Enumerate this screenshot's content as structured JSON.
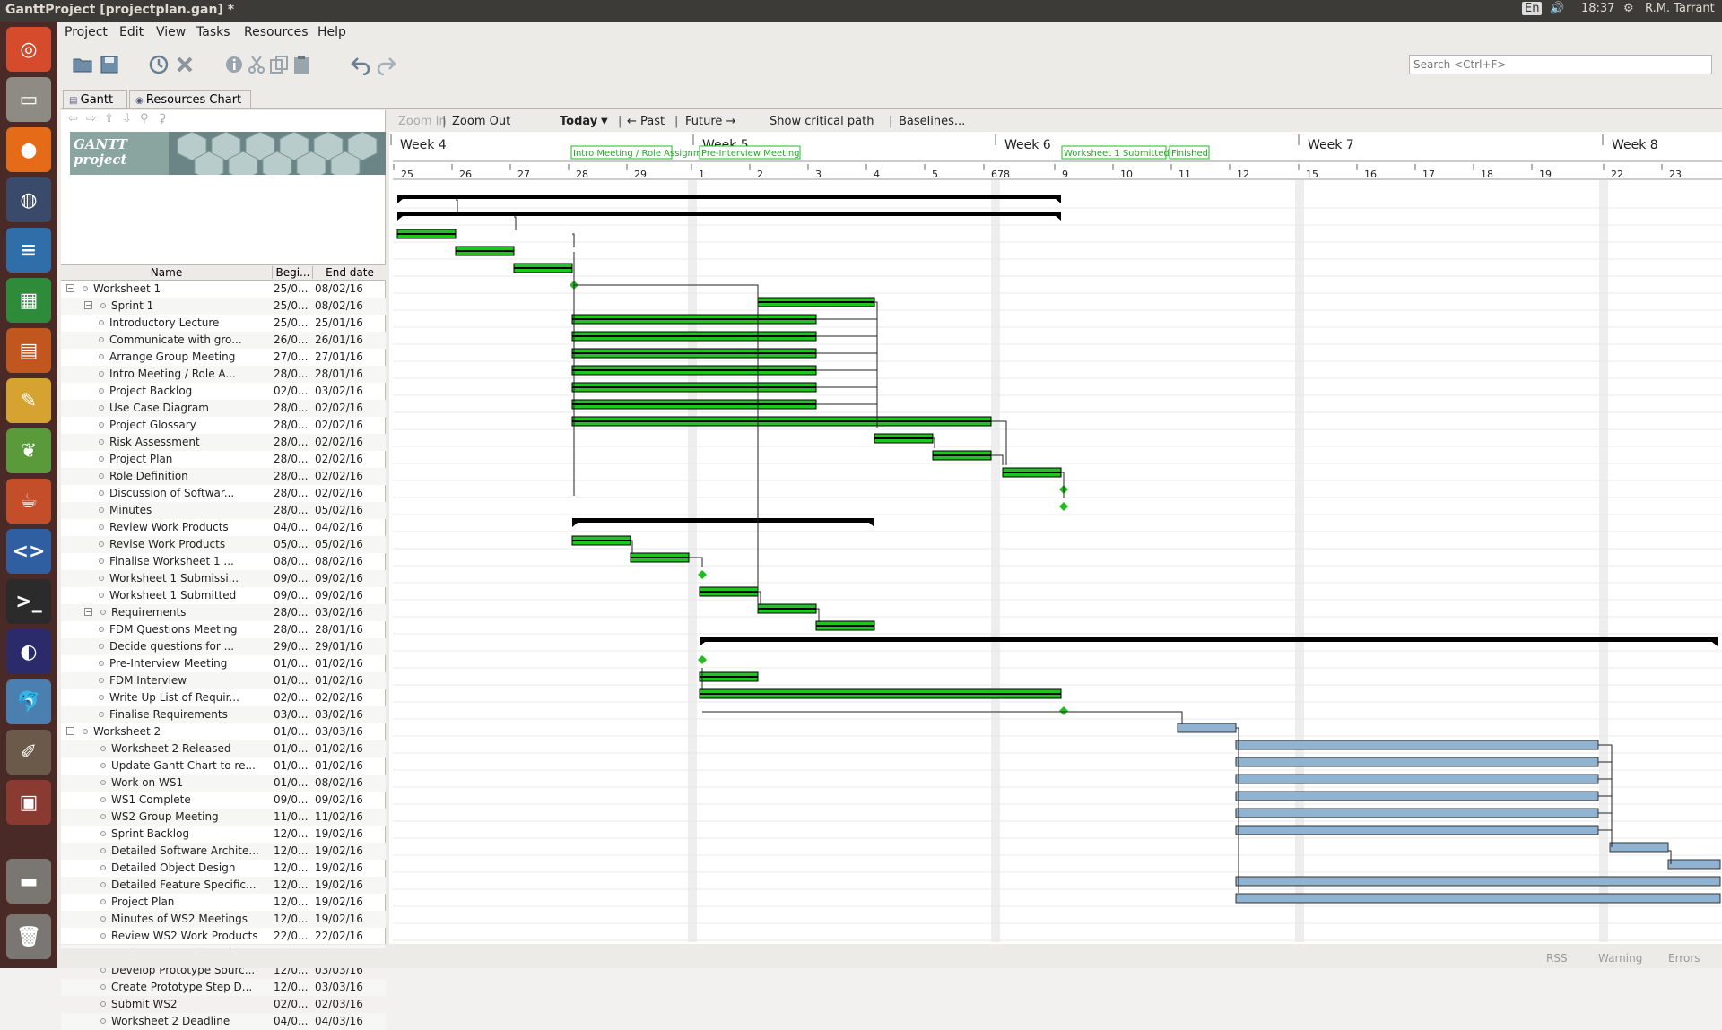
{
  "window": {
    "title": "GanttProject [projectplan.gan] *"
  },
  "topbar": {
    "keyboard": "En",
    "time": "18:37",
    "user": "R.M. Tarrant"
  },
  "menus": [
    {
      "label": "Project"
    },
    {
      "label": "Edit"
    },
    {
      "label": "View"
    },
    {
      "label": "Tasks"
    },
    {
      "label": "Resources"
    },
    {
      "label": "Help"
    }
  ],
  "search": {
    "placeholder": "Search <Ctrl+F>"
  },
  "tabs": [
    {
      "label": "Gantt"
    },
    {
      "label": "Resources Chart"
    }
  ],
  "logo": {
    "text": "GANTT project"
  },
  "columns": {
    "name": "Name",
    "begin": "Begi...",
    "end": "End date"
  },
  "chart_controls": {
    "zoom_in": "Zoom In",
    "zoom_out": "Zoom Out",
    "today": "Today",
    "past": "← Past",
    "future": "Future →",
    "critical": "Show critical path",
    "baselines": "Baselines..."
  },
  "weeks": [
    "Week 4",
    "Week 5",
    "Week 6",
    "Week 7",
    "Week 8"
  ],
  "days": [
    "25",
    "26",
    "27",
    "28",
    "29",
    "1",
    "2",
    "3",
    "4",
    "5",
    "678",
    "9",
    "10",
    "11",
    "12",
    "15",
    "16",
    "17",
    "18",
    "19",
    "22",
    "23"
  ],
  "milestone_labels": [
    "Intro Meeting / Role Assignm",
    "Pre-Interview Meeting",
    "Worksheet 1 Submitted",
    "Finished"
  ],
  "tasks": [
    {
      "name": "Worksheet 1",
      "begin": "25/0...",
      "end": "08/02/16",
      "level": 0,
      "expand": "−"
    },
    {
      "name": "Sprint 1",
      "begin": "25/0...",
      "end": "08/02/16",
      "level": 1,
      "expand": "−"
    },
    {
      "name": "Introductory Lecture",
      "begin": "25/0...",
      "end": "25/01/16",
      "level": 2
    },
    {
      "name": "Communicate with gro...",
      "begin": "26/0...",
      "end": "26/01/16",
      "level": 2
    },
    {
      "name": "Arrange Group Meeting",
      "begin": "27/0...",
      "end": "27/01/16",
      "level": 2
    },
    {
      "name": "Intro Meeting / Role A...",
      "begin": "28/0...",
      "end": "28/01/16",
      "level": 2
    },
    {
      "name": "Project Backlog",
      "begin": "02/0...",
      "end": "03/02/16",
      "level": 2
    },
    {
      "name": "Use Case Diagram",
      "begin": "28/0...",
      "end": "02/02/16",
      "level": 2
    },
    {
      "name": "Project Glossary",
      "begin": "28/0...",
      "end": "02/02/16",
      "level": 2
    },
    {
      "name": "Risk Assessment",
      "begin": "28/0...",
      "end": "02/02/16",
      "level": 2
    },
    {
      "name": "Project Plan",
      "begin": "28/0...",
      "end": "02/02/16",
      "level": 2
    },
    {
      "name": "Role Definition",
      "begin": "28/0...",
      "end": "02/02/16",
      "level": 2
    },
    {
      "name": "Discussion of Softwar...",
      "begin": "28/0...",
      "end": "02/02/16",
      "level": 2
    },
    {
      "name": "Minutes",
      "begin": "28/0...",
      "end": "05/02/16",
      "level": 2
    },
    {
      "name": "Review Work Products",
      "begin": "04/0...",
      "end": "04/02/16",
      "level": 2
    },
    {
      "name": "Revise Work Products",
      "begin": "05/0...",
      "end": "05/02/16",
      "level": 2
    },
    {
      "name": "Finalise Worksheet 1 ...",
      "begin": "08/0...",
      "end": "08/02/16",
      "level": 2
    },
    {
      "name": "Worksheet 1 Submissi...",
      "begin": "09/0...",
      "end": "09/02/16",
      "level": 2
    },
    {
      "name": "Worksheet 1 Submitted",
      "begin": "09/0...",
      "end": "09/02/16",
      "level": 2
    },
    {
      "name": "Requirements",
      "begin": "28/0...",
      "end": "03/02/16",
      "level": 1,
      "expand": "−"
    },
    {
      "name": "FDM Questions Meeting",
      "begin": "28/0...",
      "end": "28/01/16",
      "level": 2
    },
    {
      "name": "Decide questions for ...",
      "begin": "29/0...",
      "end": "29/01/16",
      "level": 2
    },
    {
      "name": "Pre-Interview Meeting",
      "begin": "01/0...",
      "end": "01/02/16",
      "level": 2
    },
    {
      "name": "FDM Interview",
      "begin": "01/0...",
      "end": "01/02/16",
      "level": 2
    },
    {
      "name": "Write Up List of Requir...",
      "begin": "02/0...",
      "end": "02/02/16",
      "level": 2
    },
    {
      "name": "Finalise Requirements",
      "begin": "03/0...",
      "end": "03/02/16",
      "level": 2
    },
    {
      "name": "Worksheet 2",
      "begin": "01/0...",
      "end": "03/03/16",
      "level": 0,
      "expand": "−"
    },
    {
      "name": "Worksheet 2 Released",
      "begin": "01/0...",
      "end": "01/02/16",
      "level": 1
    },
    {
      "name": "Update Gantt Chart to re...",
      "begin": "01/0...",
      "end": "01/02/16",
      "level": 1
    },
    {
      "name": "Work on WS1",
      "begin": "01/0...",
      "end": "08/02/16",
      "level": 1
    },
    {
      "name": "WS1 Complete",
      "begin": "09/0...",
      "end": "09/02/16",
      "level": 1
    },
    {
      "name": "WS2 Group Meeting",
      "begin": "11/0...",
      "end": "11/02/16",
      "level": 1
    },
    {
      "name": "Sprint Backlog",
      "begin": "12/0...",
      "end": "19/02/16",
      "level": 1
    },
    {
      "name": "Detailed Software Archite...",
      "begin": "12/0...",
      "end": "19/02/16",
      "level": 1
    },
    {
      "name": "Detailed Object Design",
      "begin": "12/0...",
      "end": "19/02/16",
      "level": 1
    },
    {
      "name": "Detailed Feature Specific...",
      "begin": "12/0...",
      "end": "19/02/16",
      "level": 1
    },
    {
      "name": "Project Plan",
      "begin": "12/0...",
      "end": "19/02/16",
      "level": 1
    },
    {
      "name": "Minutes of WS2 Meetings",
      "begin": "12/0...",
      "end": "19/02/16",
      "level": 1
    },
    {
      "name": "Review WS2 Work Products",
      "begin": "22/0...",
      "end": "22/02/16",
      "level": 1
    },
    {
      "name": "Revise WS2 Work Products",
      "begin": "23/0...",
      "end": "23/02/16",
      "level": 1
    },
    {
      "name": "Develop Prototype Sourc...",
      "begin": "12/0...",
      "end": "03/03/16",
      "level": 1
    },
    {
      "name": "Create Prototype Step D...",
      "begin": "12/0...",
      "end": "03/03/16",
      "level": 1
    },
    {
      "name": "Submit WS2",
      "begin": "02/0...",
      "end": "02/03/16",
      "level": 1
    },
    {
      "name": "Worksheet 2 Deadline",
      "begin": "04/0...",
      "end": "04/03/16",
      "level": 1
    }
  ],
  "status": {
    "rss": "RSS",
    "warning": "Warning",
    "errors": "Errors"
  },
  "colors": {
    "done": "#1fc41f",
    "planned": "#8fb3d0",
    "summary": "#000000",
    "milestone": "#22bb22"
  }
}
